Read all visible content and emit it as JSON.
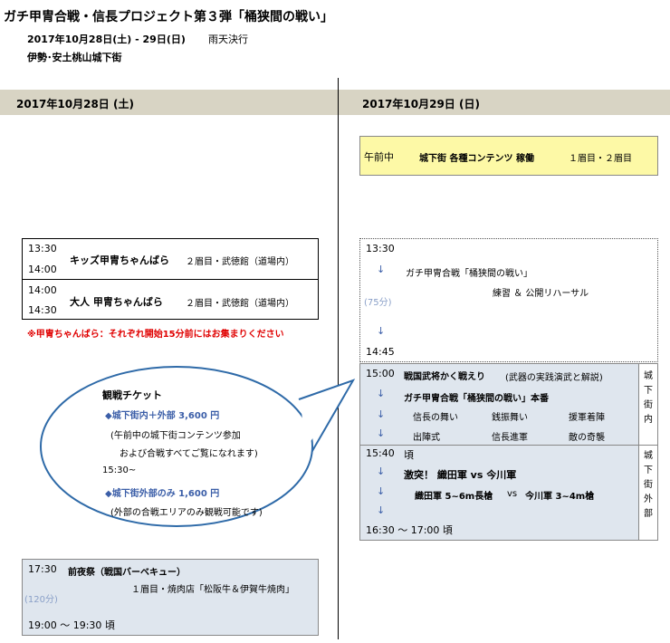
{
  "header": {
    "title": "ガチ甲冑合戦・信長プロジェクト第３弾「桶狭間の戦い」",
    "dates": "2017年10月28日(土) - 29日(日)",
    "rain": "雨天決行",
    "venue": "伊勢･安土桃山城下街"
  },
  "day1": {
    "label": "2017年10月28日 (土)",
    "events": [
      {
        "start": "13:30",
        "end": "14:00",
        "title": "キッズ甲冑ちゃんばら",
        "place": "２眉目・武徳館（道場内）"
      },
      {
        "start": "14:00",
        "end": "14:30",
        "title": "大人 甲冑ちゃんばら",
        "place": "２眉目・武徳館（道場内）"
      }
    ],
    "notice": "※甲冑ちゃんばら：それぞれ開始15分前にはお集まりください",
    "ticket": {
      "heading": "観戦チケット",
      "opt1": "◆城下街内＋外部 3,600 円",
      "opt1_note1": "(午前中の城下街コンテンツ参加",
      "opt1_note2": "および合戦すべてご覧になれます)",
      "time": "15:30~",
      "opt2": "◆城下街外部のみ 1,600 円",
      "opt2_note": "(外部の合戦エリアのみ観戦可能です)"
    },
    "eve": {
      "start": "17:30",
      "title": "前夜祭（戦国バーベキュー）",
      "place": "１眉目・焼肉店「松阪牛＆伊賀牛焼肉」",
      "duration": "(120分)",
      "end": "19:00 ～ 19:30 頃"
    }
  },
  "day2": {
    "label": "2017年10月29日 (日)",
    "morning": {
      "time": "午前中",
      "title": "城下街 各種コンテンツ 稼働",
      "place": "１眉目・２眉目"
    },
    "rehearsal": {
      "start": "13:30",
      "arrow": "↓",
      "line1": "ガチ甲冑合戦「桶狭間の戦い」",
      "line2": "練習 ＆ 公開リハーサル",
      "duration": "(75分)",
      "end": "14:45"
    },
    "battle1": {
      "start": "15:00",
      "title": "戦国武将かく戦えり",
      "sub": "(武器の実践演武と解説)",
      "main": "ガチ甲冑合戦「桶狭間の戦い」本番",
      "items": [
        "信長の舞い",
        "銭振舞い",
        "援軍着陣",
        "出陣式",
        "信長進軍",
        "敵の奇襲"
      ],
      "side": "城下街内"
    },
    "battle2": {
      "start": "15:40",
      "approx": "頃",
      "title": "激突！ 織田軍 vs 今川軍",
      "detail_a": "織田軍 5~6m長槍",
      "detail_vs": "vs",
      "detail_b": "今川軍 3~4m槍",
      "end": "16:30 ～ 17:00 頃",
      "side": "城下街外部"
    }
  }
}
